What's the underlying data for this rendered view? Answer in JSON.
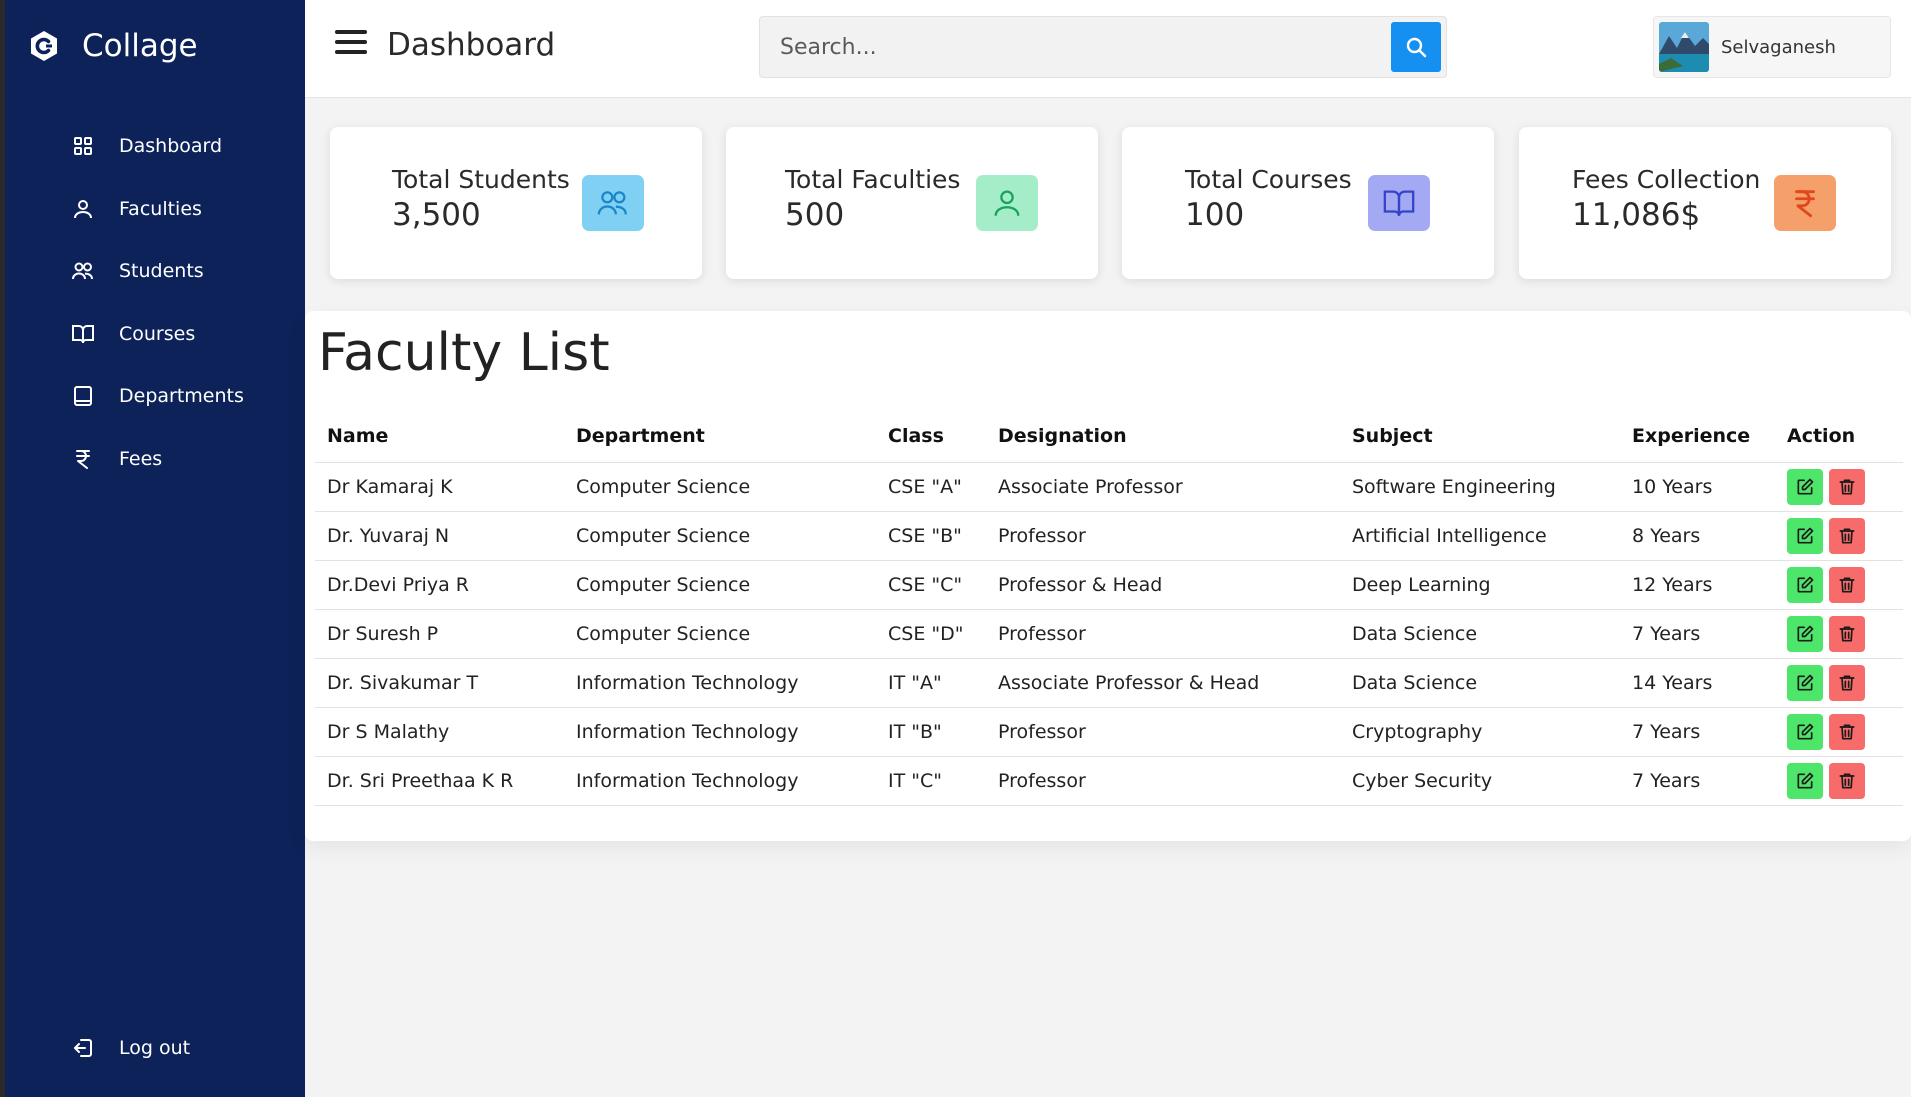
{
  "brand": {
    "name": "Collage",
    "logo_icon": "collage-logo-icon"
  },
  "sidebar": {
    "items": [
      {
        "label": "Dashboard",
        "icon": "grid-icon"
      },
      {
        "label": "Faculties",
        "icon": "user-icon"
      },
      {
        "label": "Students",
        "icon": "users-icon"
      },
      {
        "label": "Courses",
        "icon": "book-icon"
      },
      {
        "label": "Departments",
        "icon": "tablet-icon"
      },
      {
        "label": "Fees",
        "icon": "rupee-icon"
      }
    ],
    "logout_label": "Log out"
  },
  "header": {
    "title": "Dashboard",
    "search_placeholder": "Search...",
    "user_name": "Selvaganesh"
  },
  "stats": [
    {
      "title": "Total Students",
      "value": "3,500",
      "icon": "users-icon",
      "bg": "#7fd0f3",
      "fg": "#1a86c9"
    },
    {
      "title": "Total Faculties",
      "value": "500",
      "icon": "user-icon",
      "bg": "#a5ecc9",
      "fg": "#17a35c"
    },
    {
      "title": "Total Courses",
      "value": "100",
      "icon": "book-icon",
      "bg": "#a4a9f3",
      "fg": "#3443c9"
    },
    {
      "title": "Fees Collection",
      "value": "11,086$",
      "icon": "rupee-icon",
      "bg": "#f5a06b",
      "fg": "#e2471b"
    }
  ],
  "faculty": {
    "title": "Faculty List",
    "columns": [
      "Name",
      "Department",
      "Class",
      "Designation",
      "Subject",
      "Experience",
      "Action"
    ],
    "rows": [
      [
        "Dr Kamaraj K",
        "Computer Science",
        "CSE \"A\"",
        "Associate Professor",
        "Software Engineering",
        "10 Years"
      ],
      [
        "Dr. Yuvaraj N",
        "Computer Science",
        "CSE \"B\"",
        "Professor",
        "Artificial Intelligence",
        "8 Years"
      ],
      [
        "Dr.Devi Priya R",
        "Computer Science",
        "CSE \"C\"",
        "Professor & Head",
        "Deep Learning",
        "12 Years"
      ],
      [
        "Dr Suresh P",
        "Computer Science",
        "CSE \"D\"",
        "Professor",
        "Data Science",
        "7 Years"
      ],
      [
        "Dr. Sivakumar T",
        "Information Technology",
        "IT \"A\"",
        "Associate Professor & Head",
        "Data Science",
        "14 Years"
      ],
      [
        "Dr S Malathy",
        "Information Technology",
        "IT \"B\"",
        "Professor",
        "Cryptography",
        "7 Years"
      ],
      [
        "Dr. Sri Preethaa K R",
        "Information Technology",
        "IT \"C\"",
        "Professor",
        "Cyber Security",
        "7 Years"
      ]
    ],
    "action_icons": [
      "edit-icon",
      "trash-icon"
    ]
  },
  "colors": {
    "sidebar_bg": "#0d2258",
    "search_button": "#1590f0",
    "edit_button": "#4ee66a",
    "delete_button": "#f76b6b"
  }
}
